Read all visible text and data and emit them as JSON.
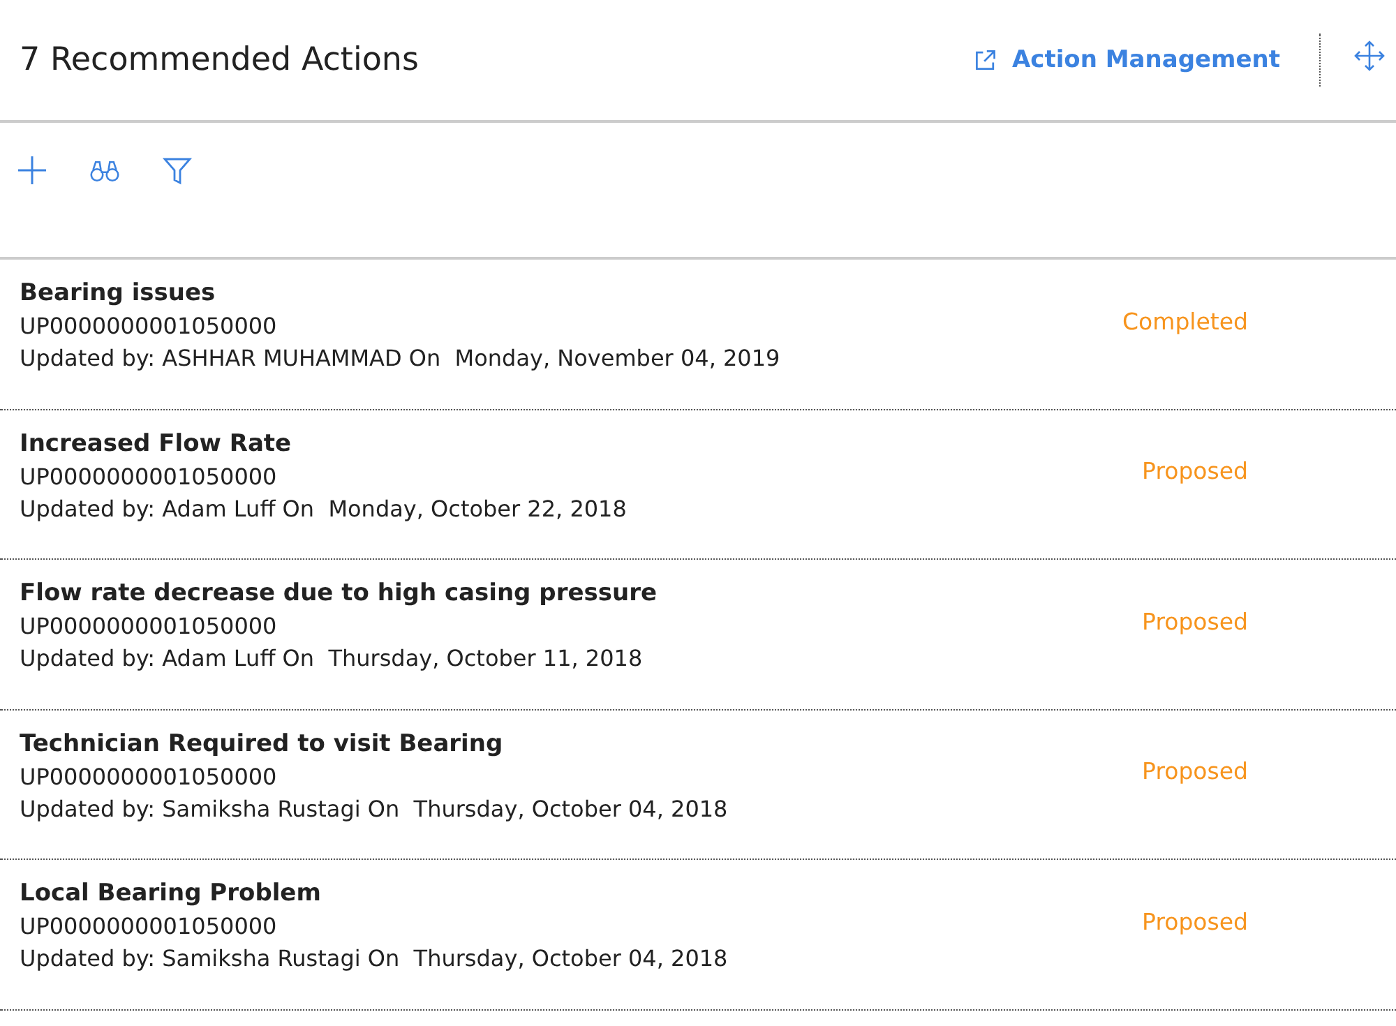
{
  "header": {
    "title": "7 Recommended Actions",
    "link": "Action Management"
  },
  "actions": [
    {
      "title": "Bearing issues",
      "id": "UP0000000001050000",
      "updated": "Updated by: ASHHAR MUHAMMAD On  Monday, November 04, 2019",
      "status": "Completed"
    },
    {
      "title": "Increased Flow Rate",
      "id": "UP0000000001050000",
      "updated": "Updated by: Adam Luff On  Monday, October 22, 2018",
      "status": "Proposed"
    },
    {
      "title": "Flow rate decrease due to high casing pressure",
      "id": "UP0000000001050000",
      "updated": "Updated by: Adam Luff On  Thursday, October 11, 2018",
      "status": "Proposed"
    },
    {
      "title": "Technician Required to visit Bearing",
      "id": "UP0000000001050000",
      "updated": "Updated by: Samiksha Rustagi On  Thursday, October 04, 2018",
      "status": "Proposed"
    },
    {
      "title": "Local Bearing Problem",
      "id": "UP0000000001050000",
      "updated": "Updated by: Samiksha Rustagi On  Thursday, October 04, 2018",
      "status": "Proposed"
    }
  ]
}
